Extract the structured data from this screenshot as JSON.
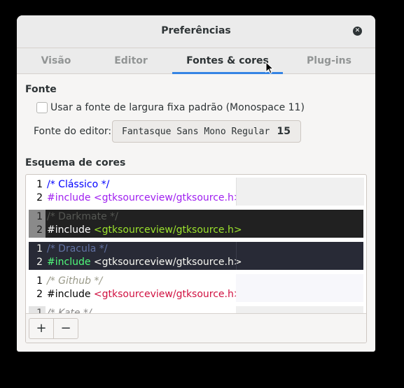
{
  "window": {
    "title": "Preferências"
  },
  "tabs": [
    {
      "label": "Visão"
    },
    {
      "label": "Editor"
    },
    {
      "label": "Fontes & cores"
    },
    {
      "label": "Plug-ins"
    }
  ],
  "font_section": {
    "title": "Fonte",
    "checkbox_label": "Usar a fonte de largura fixa padrão (Monospace 11)",
    "checkbox_checked": false,
    "editor_font_label": "Fonte do editor:",
    "editor_font_name": "Fantasque Sans Mono Regular",
    "editor_font_size": "15"
  },
  "scheme_section": {
    "title": "Esquema de cores",
    "schemes": [
      {
        "line1": "/* Clássico */",
        "line2_kw": "#include",
        "line2_str": "<gtksourceview/gtksource.h>"
      },
      {
        "line1": "/* Darkmate */",
        "line2_kw": "#include",
        "line2_str": "<gtksourceview/gtksource.h>"
      },
      {
        "line1": "/* Dracula */",
        "line2_kw": "#include",
        "line2_str": "<gtksourceview/gtksource.h>"
      },
      {
        "line1": "/* Github */",
        "line2_kw": "#include",
        "line2_str": "<gtksourceview/gtksource.h>"
      },
      {
        "line1": "/* Kate */"
      }
    ],
    "add_label": "+",
    "remove_label": "−"
  },
  "line_numbers": [
    "1",
    "2"
  ],
  "colors": {
    "accent": "#3584e4",
    "classic_comment": "#0000ff",
    "classic_include": "#a020f0",
    "darkmate_bg": "#212121",
    "darkmate_string": "#9be22d",
    "dracula_bg": "#282a36",
    "dracula_comment": "#6272a4",
    "dracula_include": "#50fa7b",
    "github_string": "#d01040"
  }
}
